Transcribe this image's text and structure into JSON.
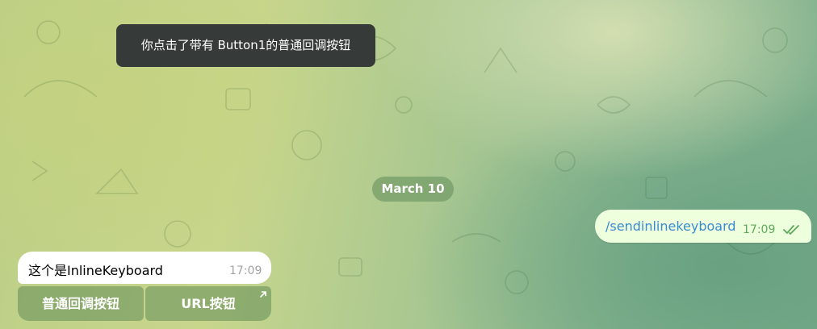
{
  "toast": {
    "text": "你点击了带有 Button1的普通回调按钮"
  },
  "date_badge": {
    "text": "March 10"
  },
  "outgoing_message": {
    "text": "/sendinlinekeyboard",
    "time": "17:09",
    "status_icon": "double-check-icon"
  },
  "incoming_message": {
    "text": "这个是InlineKeyboard",
    "time": "17:09"
  },
  "inline_keyboard": {
    "buttons": [
      {
        "label": "普通回调按钮"
      },
      {
        "label": "URL按钮",
        "icon": "external-link-arrow-icon"
      }
    ]
  },
  "colors": {
    "toast_bg": "#363b39",
    "outgoing_bubble": "#eeffde",
    "incoming_bubble": "#ffffff",
    "command_link": "#3a8ad0",
    "read_check": "#5ea95b"
  }
}
